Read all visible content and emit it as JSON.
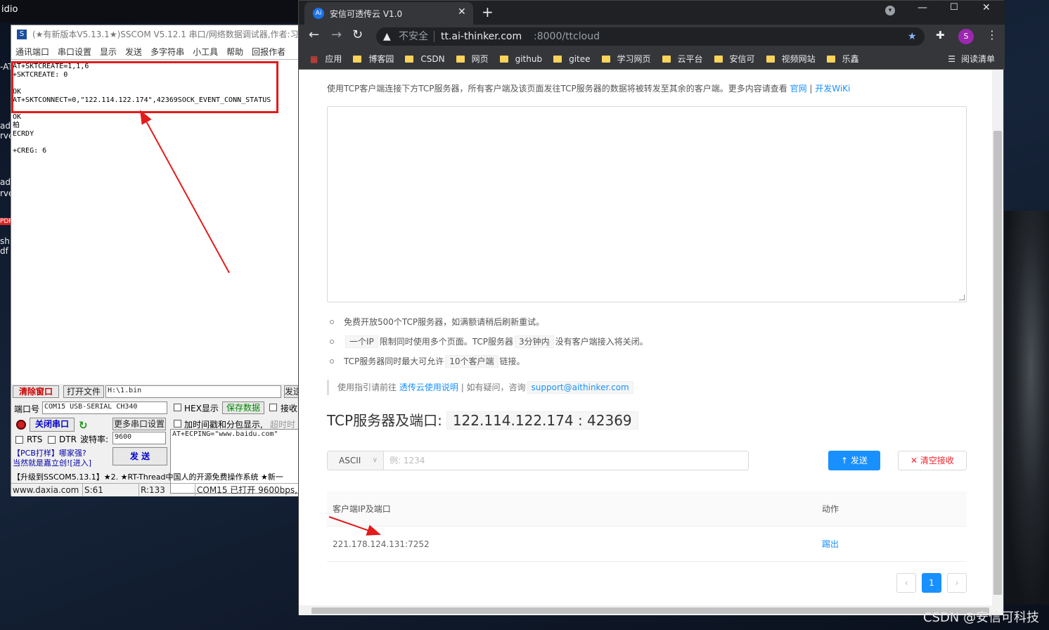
{
  "desktop": {
    "top_label": "idio",
    "side_labels": [
      "-AT",
      "ad",
      "rve",
      "ad",
      "rve",
      "PDF",
      "sh",
      "df"
    ],
    "watermark": "CSDN @安信可科技"
  },
  "sscom": {
    "title": "(★有新版本V5.13.1★)SSCOM V5.12.1 串口/网络数据调试器,作者:习小",
    "menu": [
      "通讯端口",
      "串口设置",
      "显示",
      "发送",
      "多字符串",
      "小工具",
      "帮助",
      "回报作者"
    ],
    "receive_lines": [
      "AT+SKTCREATE=1,1,6",
      "+SKTCREATE: 0",
      "",
      "OK",
      "AT+SKTCONNECT=0,\"122.114.122.174\",42369SOCK_EVENT_CONN_STATUS",
      "",
      "OK",
      "柏",
      "ECRDY",
      "",
      "+CREG: 6"
    ],
    "clear_btn": "清除窗口",
    "open_file_btn": "打开文件",
    "file_path": "H:\\1.bin",
    "send_file_btn": "发送",
    "port_label": "端口号",
    "port_value": "COM15 USB-SERIAL CH340",
    "hex_display": "HEX显示",
    "save_data_btn": "保存数据",
    "recv_label": "接收",
    "close_port_btn": "关闭串口",
    "more_settings_btn": "更多串口设置",
    "timestamp_label": "加时间戳和分包显示,",
    "timeout_label": "超时时",
    "rts_label": "RTS",
    "dtr_label": "DTR",
    "baud_label": "波特率:",
    "baud_value": "9600",
    "send_text": "AT+ECPING=\"www.baidu.com\"",
    "ad_line1": "【PCB打样】哪家强?",
    "ad_line2": "当然就是嘉立创![进入]",
    "send_btn": "发 送",
    "ticker": "【升级到SSCOM5.13.1】★2. ★RT-Thread中国人的开源免费操作系统 ★新一",
    "status": [
      "www.daxia.com",
      "S:61",
      "R:133",
      "COM15 已打开  9600bps,"
    ]
  },
  "chrome": {
    "tab_title": "安信可透传云 V1.0",
    "tab_icon": "Ai",
    "url_security": "不安全",
    "url_host": "tt.ai-thinker.com",
    "url_path": ":8000/ttcloud",
    "profile_initial": "S",
    "bookmarks": [
      "应用",
      "博客园",
      "CSDN",
      "网页",
      "github",
      "gitee",
      "学习网页",
      "云平台",
      "安信可",
      "视频网站",
      "乐鑫"
    ],
    "reading_list": "阅读清单"
  },
  "page": {
    "intro": "使用TCP客户端连接下方TCP服务器，所有客户端及该页面发往TCP服务器的数据将被转发至其余的客户端。更多内容请查看",
    "intro_link1": "官网",
    "intro_sep": " | ",
    "intro_link2": "开发WiKi",
    "info1": "免费开放500个TCP服务器，如满额请稍后刷新重试。",
    "info2_code1": "一个IP",
    "info2_mid": "限制同时使用多个页面。TCP服务器",
    "info2_code2": "3分钟内",
    "info2_end": "没有客户端接入将关闭。",
    "info3_start": "TCP服务器同时最大可允许",
    "info3_code": "10个客户端",
    "info3_end": "链接。",
    "guide_start": "使用指引请前往",
    "guide_link": "透传云使用说明",
    "guide_mid": "| 如有疑问，咨询",
    "guide_email": "support@aithinker.com",
    "tcp_title": "TCP服务器及端口:",
    "tcp_address": "122.114.122.174 : 42369",
    "mode": "ASCII",
    "send_placeholder": "例: 1234",
    "send_btn": "发送",
    "clear_btn": "清空接收",
    "table_headers": [
      "客户端IP及端口",
      "动作"
    ],
    "client_ip": "221.178.124.131:7252",
    "kick_action": "踢出",
    "page_num": "1"
  }
}
